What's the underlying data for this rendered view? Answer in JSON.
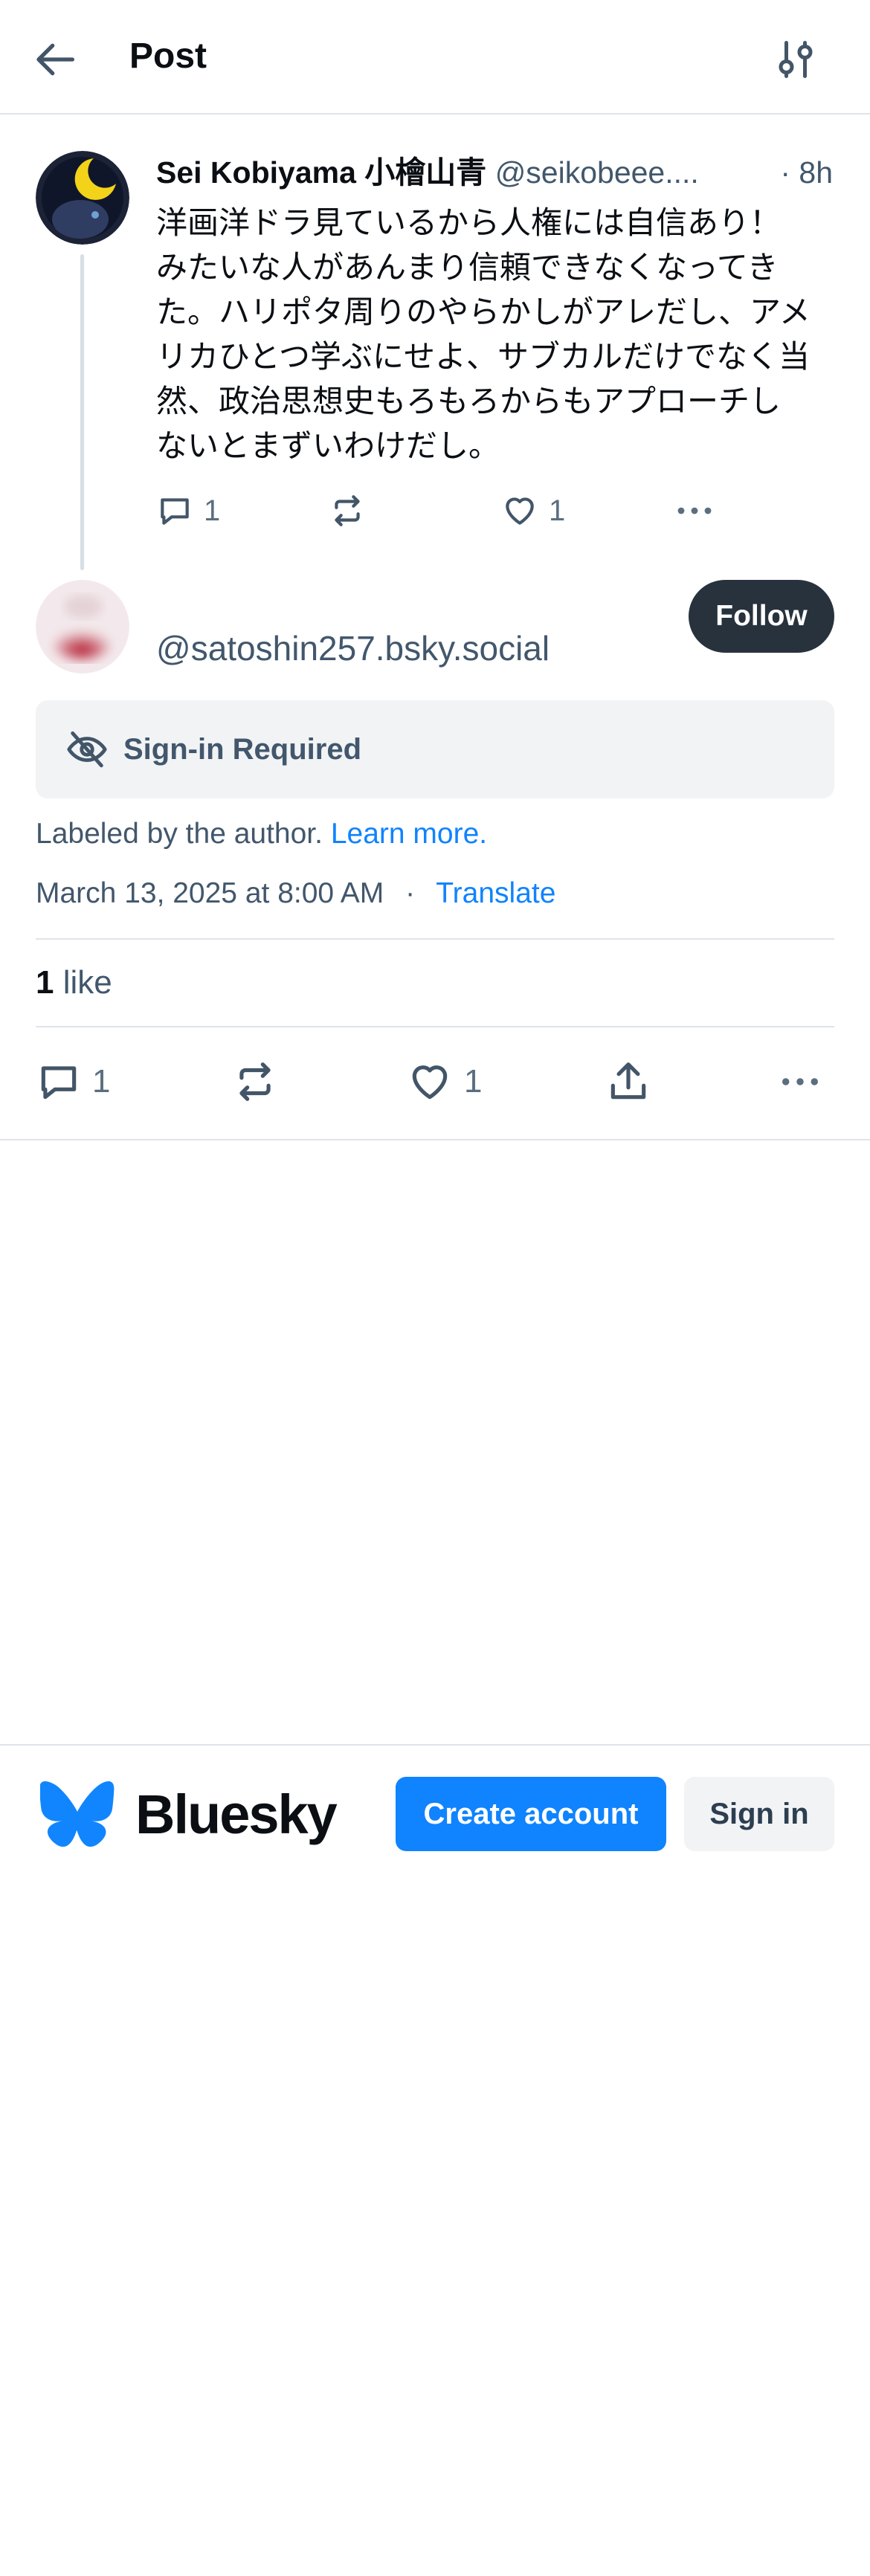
{
  "header": {
    "title": "Post",
    "back_icon": "arrow-left-icon",
    "settings_icon": "sliders-icon"
  },
  "parent_post": {
    "author_name": "Sei Kobiyama 小檜山青",
    "author_handle": "@seikobeee....",
    "time": "· 8h",
    "text": "洋画洋ドラ見ているから人権には自信あり！みたいな人があんまり信頼できなくなってきた。ハリポタ周りのやらかしがアレだし、アメリカひとつ学ぶにせよ、サブカルだけでなく当然、政治思想史もろもろからもアプローチしないとまずいわけだし。",
    "reply_count": "1",
    "like_count": "1"
  },
  "main_post": {
    "handle": "@satoshin257.bsky.social",
    "follow_label": "Follow",
    "signin_required_label": "Sign-in Required",
    "labeled_text": "Labeled by the author.",
    "learn_more_label": "Learn more.",
    "date": "March 13, 2025 at 8:00 AM",
    "separator": "·",
    "translate_label": "Translate",
    "likes_number": "1",
    "likes_word": "like",
    "reply_count": "1",
    "like_count": "1"
  },
  "footer": {
    "brand": "Bluesky",
    "create_account_label": "Create account",
    "sign_in_label": "Sign in"
  },
  "colors": {
    "accent": "#1083fe",
    "follow_button": "#28323d",
    "muted_text": "#42576c"
  }
}
